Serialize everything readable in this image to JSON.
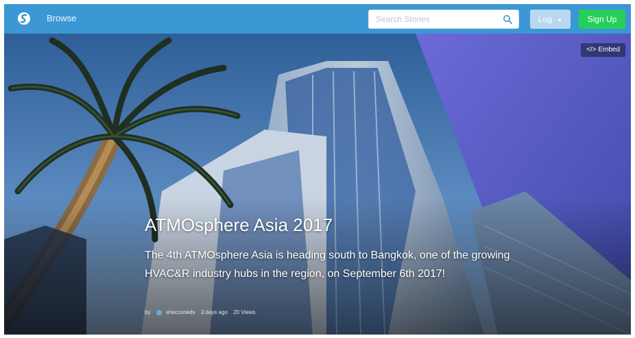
{
  "nav": {
    "browse_label": "Browse",
    "search_placeholder": "Search Stories",
    "login_label": "Log",
    "signup_label": "Sign Up"
  },
  "hero": {
    "embed_label": "</> Embed",
    "title": "ATMOsphere Asia 2017",
    "description": "The 4th ATMOsphere Asia is heading south to Bangkok, one of the growing HVAC&R industry hubs in the region, on September 6th 2017!",
    "meta": {
      "by": "by",
      "author": "shecconeds",
      "time": "3 days ago",
      "views": "20 Views"
    }
  },
  "colors": {
    "topbar": "#3c97d5",
    "signup": "#26cf59",
    "login": "#b9d8ef"
  }
}
